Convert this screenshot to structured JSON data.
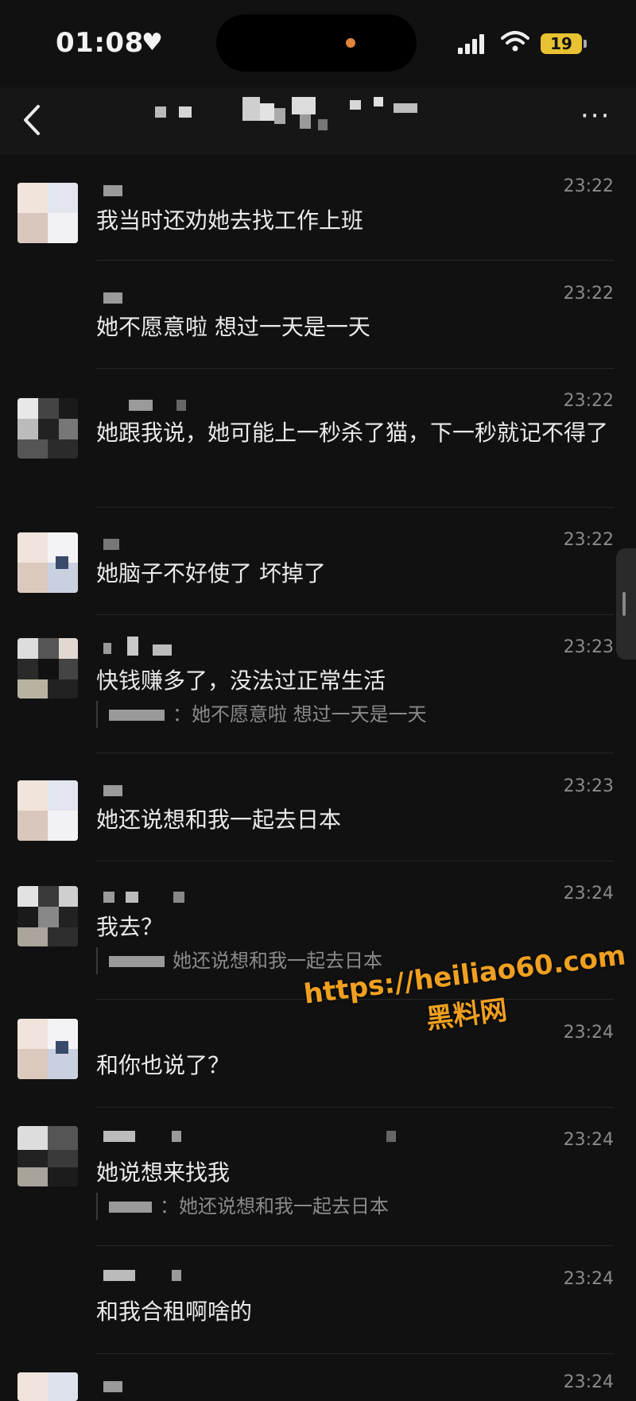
{
  "status_bar": {
    "time": "01:08",
    "battery": "19"
  },
  "nav": {
    "back_icon": "chevron-left-icon",
    "more_label": "···"
  },
  "messages": [
    {
      "time": "23:22",
      "text": "我当时还劝她去找工作上班"
    },
    {
      "time": "23:22",
      "text": "她不愿意啦 想过一天是一天"
    },
    {
      "time": "23:22",
      "text": "她跟我说，她可能上一秒杀了猫，下一秒就记不得了"
    },
    {
      "time": "23:22",
      "text": "她脑子不好使了 坏掉了"
    },
    {
      "time": "23:23",
      "text": "快钱赚多了，没法过正常生活",
      "quote": "：她不愿意啦 想过一天是一天"
    },
    {
      "time": "23:23",
      "text": "她还说想和我一起去日本"
    },
    {
      "time": "23:24",
      "text": "我去？",
      "quote": "她还说想和我一起去日本"
    },
    {
      "time": "23:24",
      "text": "和你也说了？"
    },
    {
      "time": "23:24",
      "text": "她说想来找我",
      "quote": "：她还说想和我一起去日本"
    },
    {
      "time": "23:24",
      "text": "和我合租啊啥的"
    },
    {
      "time": "23:24",
      "text": ""
    }
  ],
  "watermark": {
    "url": "https://heiliao60.com",
    "name": "黑料网"
  }
}
